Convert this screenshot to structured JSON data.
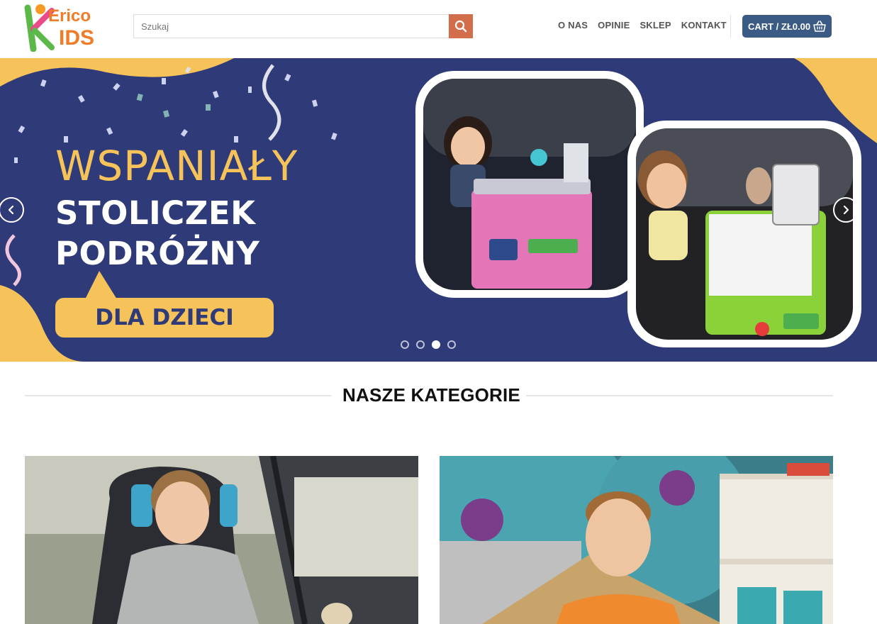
{
  "header": {
    "logo_text_top": "Erico",
    "logo_text_bottom": "KIDS",
    "search_placeholder": "Szukaj",
    "nav": [
      "O NAS",
      "OPINIE",
      "SKLEP",
      "KONTAKT"
    ],
    "cart_label": "CART / ZŁ0.00"
  },
  "hero": {
    "title": "WSPANIAŁY",
    "line2": "STOLICZEK",
    "line3": "PODRÓŻNY",
    "badge": "DLA DZIECI",
    "slide_count": 4,
    "active_slide": 3
  },
  "section": {
    "title": "NASZE KATEGORIE"
  },
  "colors": {
    "accent": "#d26e4b",
    "cart": "#3b5a84",
    "hero_bg": "#2f3a78",
    "hero_yellow": "#f6c35b"
  },
  "icons": {
    "search": "search-icon",
    "cart": "basket-icon",
    "prev": "chevron-left-icon",
    "next": "chevron-right-icon"
  }
}
